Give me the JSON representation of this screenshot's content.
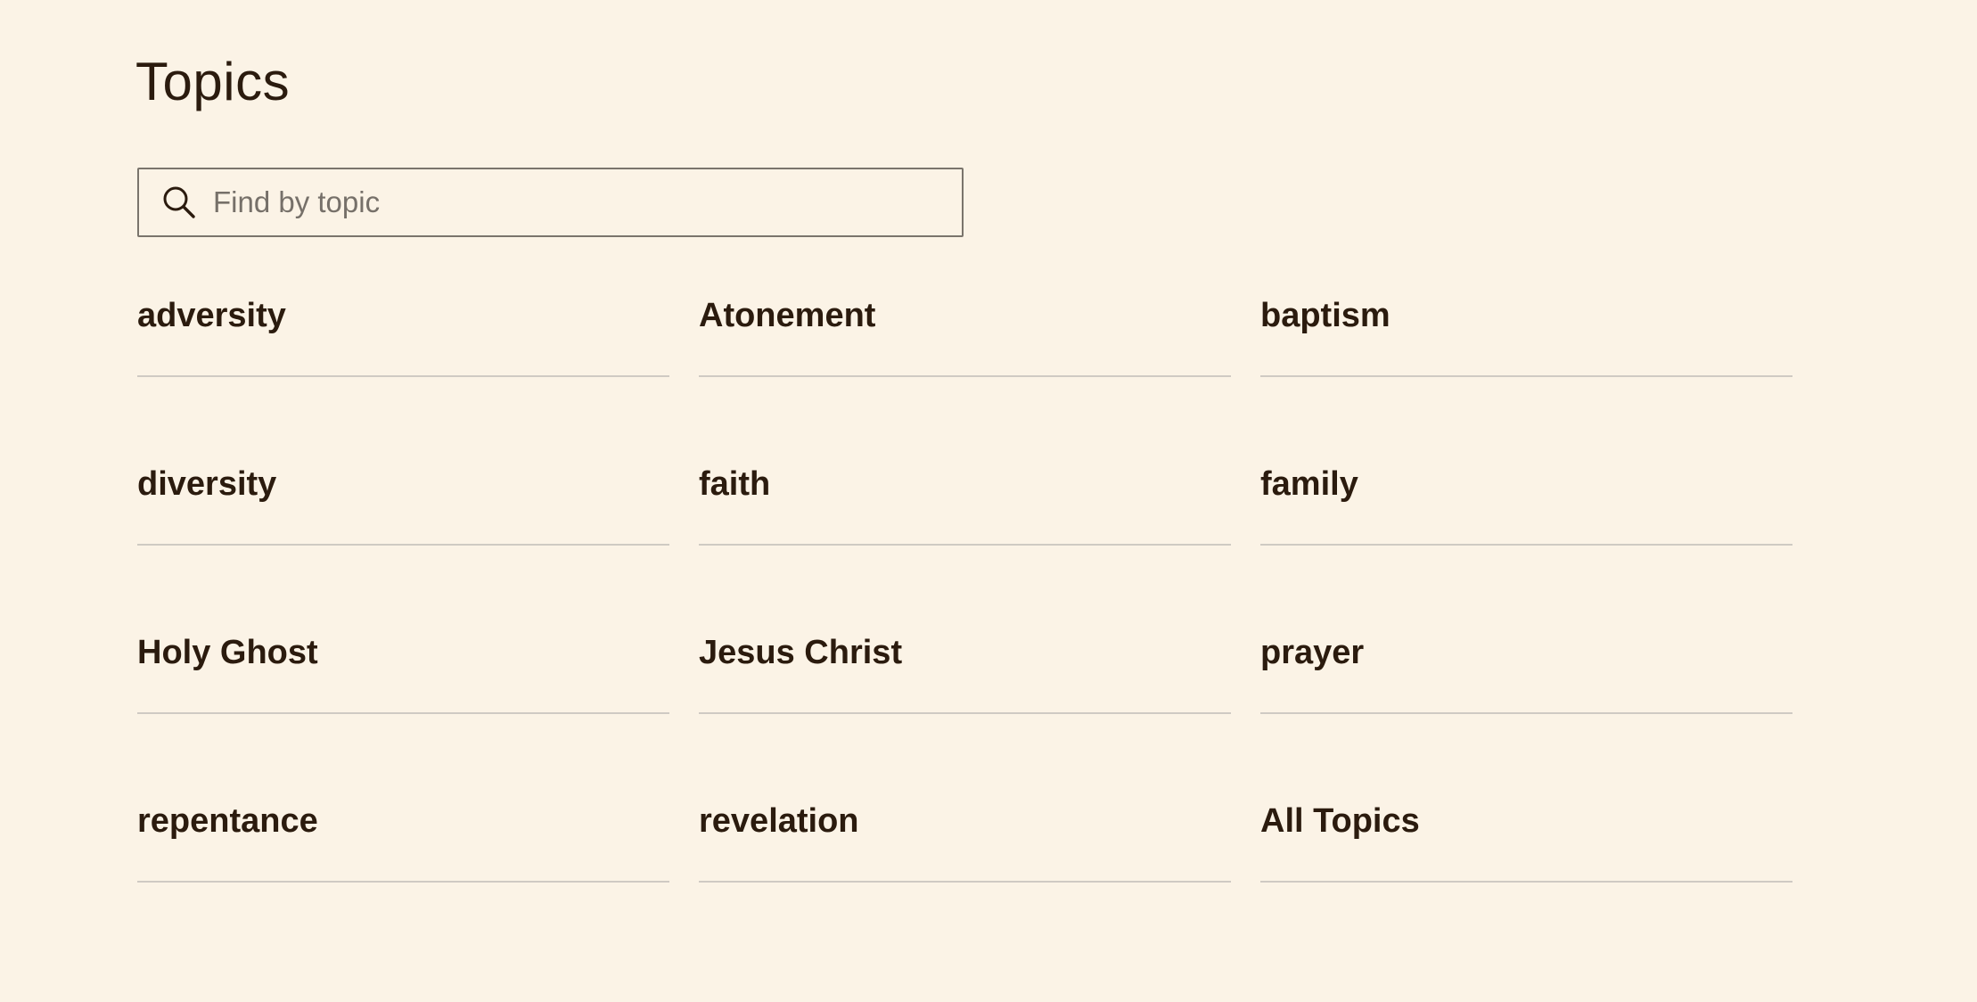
{
  "page": {
    "title": "Topics"
  },
  "search": {
    "placeholder": "Find by topic",
    "value": "",
    "icon": "search-icon"
  },
  "topics": [
    {
      "label": "adversity"
    },
    {
      "label": "Atonement"
    },
    {
      "label": "baptism"
    },
    {
      "label": "diversity"
    },
    {
      "label": "faith"
    },
    {
      "label": "family"
    },
    {
      "label": "Holy Ghost"
    },
    {
      "label": "Jesus Christ"
    },
    {
      "label": "prayer"
    },
    {
      "label": "repentance"
    },
    {
      "label": "revelation"
    },
    {
      "label": "All Topics"
    }
  ],
  "colors": {
    "background": "#fbf3e6",
    "text": "#2b1b0e",
    "divider": "#cfcac3",
    "search_border": "#7a746c",
    "placeholder": "#767069"
  }
}
